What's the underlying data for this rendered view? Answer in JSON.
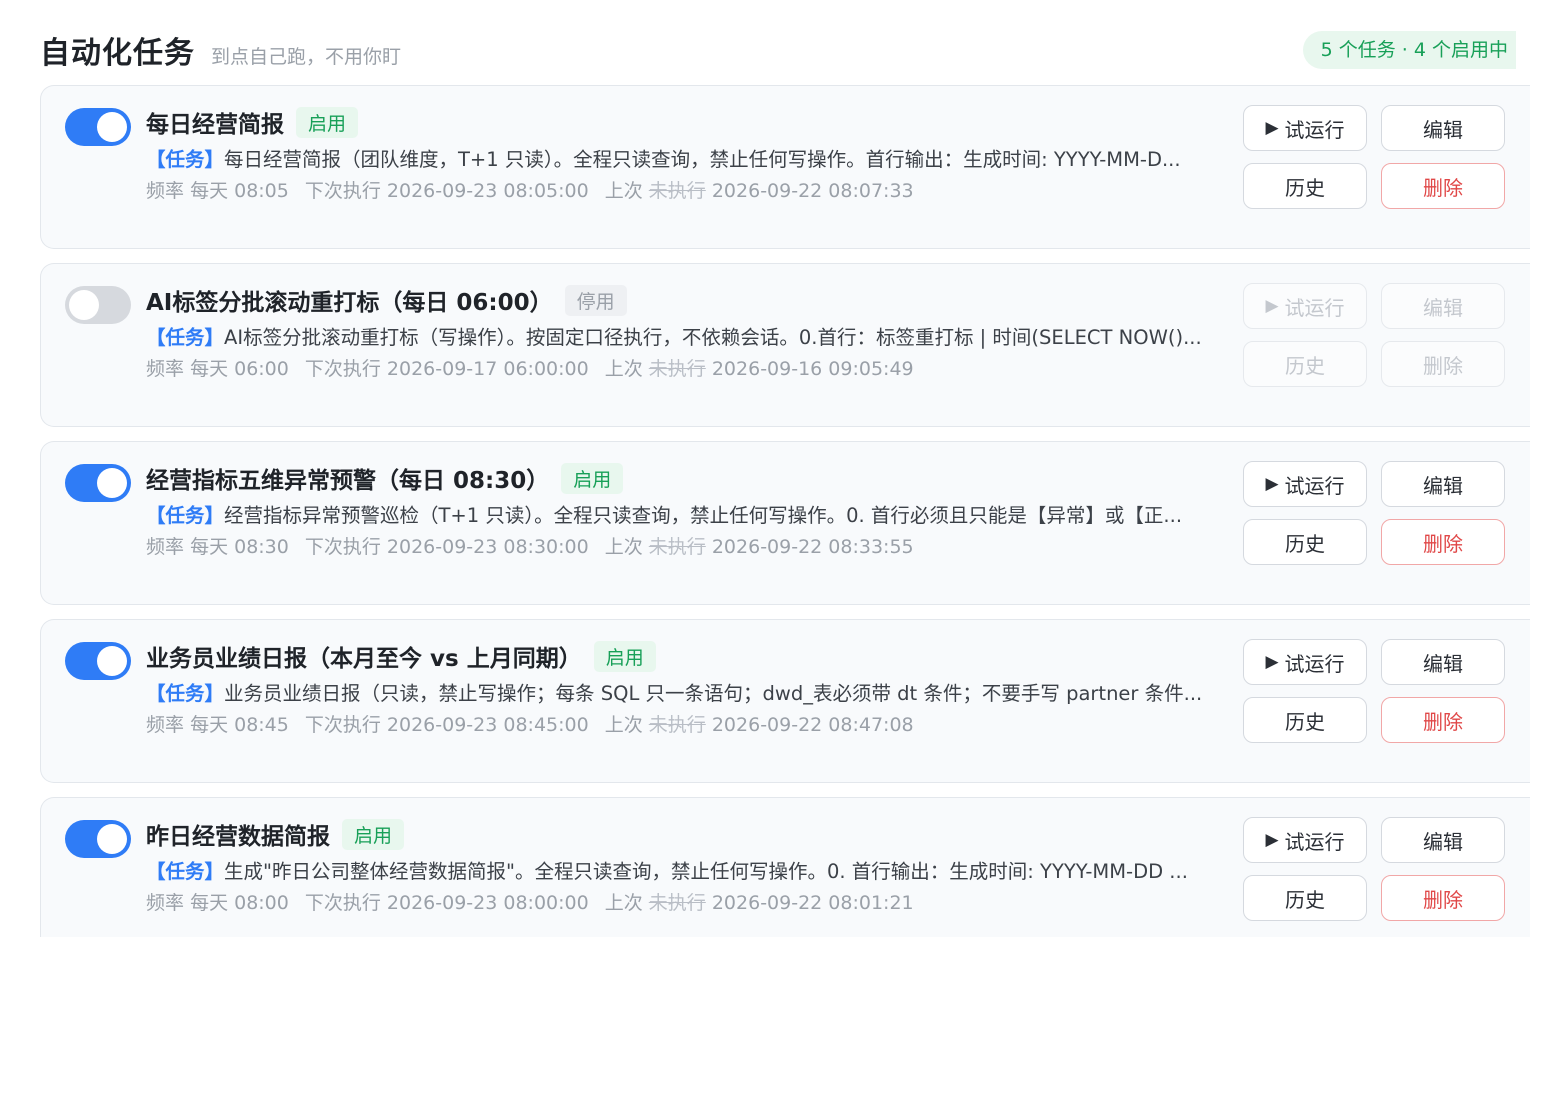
{
  "header": {
    "title": "自动化任务",
    "subtitle": "到点自己跑，不用你盯",
    "summary": "5 个任务 · 4 个启用中"
  },
  "labels": {
    "task_tag": "【任务】",
    "freq": "频率",
    "next": "下次执行",
    "last": "上次",
    "not_run": "未执行",
    "run": "试运行",
    "edit": "编辑",
    "history": "历史",
    "delete": "删除"
  },
  "tasks": [
    {
      "name": "每日经营简报",
      "enabled": true,
      "status": "启用",
      "desc": "每日经营简报（团队维度，T+1 只读）。全程只读查询，禁止任何写操作。首行输出：生成时间: YYYY-MM-D...",
      "freq": "每天 08:05",
      "next": "2026-09-23 08:05:00",
      "last": "2026-09-22 08:07:33"
    },
    {
      "name": "AI标签分批滚动重打标（每日 06:00）",
      "enabled": false,
      "status": "停用",
      "desc": "AI标签分批滚动重打标（写操作）。按固定口径执行，不依赖会话。0.首行：标签重打标 | 时间(SELECT NOW()...",
      "freq": "每天 06:00",
      "next": "2026-09-17 06:00:00",
      "last": "2026-09-16 09:05:49"
    },
    {
      "name": "经营指标五维异常预警（每日 08:30）",
      "enabled": true,
      "status": "启用",
      "desc": "经营指标异常预警巡检（T+1 只读）。全程只读查询，禁止任何写操作。0. 首行必须且只能是【异常】或【正...",
      "freq": "每天 08:30",
      "next": "2026-09-23 08:30:00",
      "last": "2026-09-22 08:33:55"
    },
    {
      "name": "业务员业绩日报（本月至今 vs 上月同期）",
      "enabled": true,
      "status": "启用",
      "desc": "业务员业绩日报（只读，禁止写操作；每条 SQL 只一条语句；dwd_表必须带 dt 条件；不要手写 partner 条件...",
      "freq": "每天 08:45",
      "next": "2026-09-23 08:45:00",
      "last": "2026-09-22 08:47:08"
    },
    {
      "name": "昨日经营数据简报",
      "enabled": true,
      "status": "启用",
      "desc": "生成\"昨日公司整体经营数据简报\"。全程只读查询，禁止任何写操作。0. 首行输出：生成时间: YYYY-MM-DD ...",
      "freq": "每天 08:00",
      "next": "2026-09-23 08:00:00",
      "last": "2026-09-22 08:01:21"
    }
  ]
}
